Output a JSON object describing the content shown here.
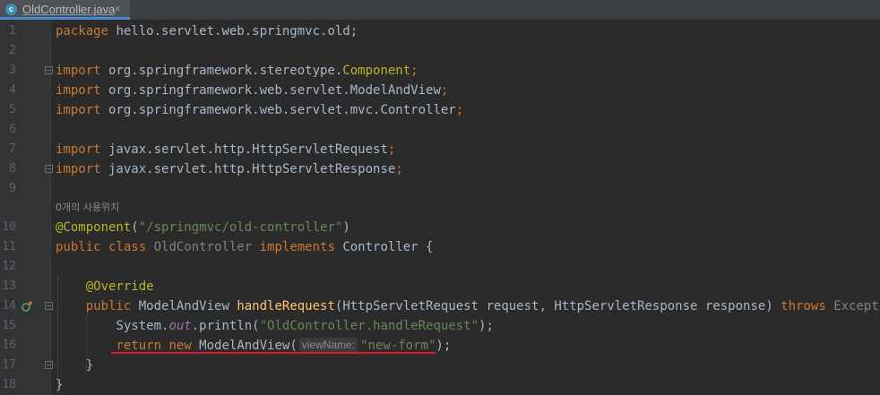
{
  "tab": {
    "icon": "c",
    "label": "OldController.java",
    "close": "×"
  },
  "lines": {
    "n1": "1",
    "n2": "2",
    "n3": "3",
    "n4": "4",
    "n5": "5",
    "n6": "6",
    "n7": "7",
    "n8": "8",
    "n9": "9",
    "n10": "10",
    "n11": "11",
    "n12": "12",
    "n13": "13",
    "n14": "14",
    "n15": "15",
    "n16": "16",
    "n17": "17",
    "n18": "18"
  },
  "code": {
    "package_kw": "package",
    "package_name": " hello.servlet.web.springmvc.old;",
    "import_kw": "import",
    "imp1": " org.springframework.stereotype.",
    "imp1_cls": "Component",
    "imp2": " org.springframework.web.servlet.ModelAndView",
    "imp3": " org.springframework.web.servlet.mvc.Controller",
    "imp4": " javax.servlet.http.HttpServletRequest",
    "imp5": " javax.servlet.http.HttpServletResponse",
    "semi": ";",
    "usage": "0개의 사용위치",
    "component_ann": "@Component",
    "component_open": "(",
    "component_str": "\"/springmvc/old-controller\"",
    "component_close": ")",
    "public_kw": "public",
    "class_kw": " class ",
    "class_name": "OldController",
    "implements_kw": " implements ",
    "iface": "Controller {",
    "override_ann": "@Override",
    "ret_type": " ModelAndView ",
    "method_name": "handleRequest",
    "params": "(HttpServletRequest request, HttpServletResponse response) ",
    "throws_kw": "throws",
    "exception": " Exception",
    "brace_open": " {",
    "sys": "System.",
    "out": "out",
    "println": ".println(",
    "println_str": "\"OldController.handleRequest\"",
    "close_paren_semi": ");",
    "return_kw": "return",
    "new_kw": " new ",
    "mav_call": "ModelAndView(",
    "hint": "viewName:",
    "view_str": "\"new-form\"",
    "close_inner": "}",
    "close_outer": "}"
  }
}
